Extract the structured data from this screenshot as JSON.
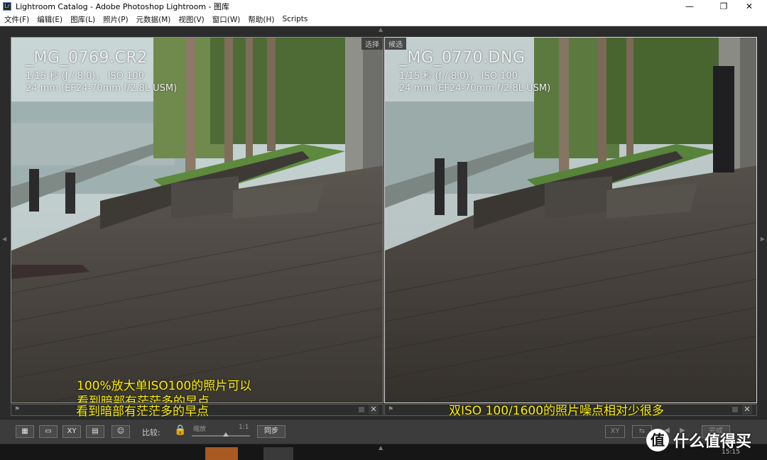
{
  "window": {
    "title": "Lightroom Catalog - Adobe Photoshop Lightroom - 图库",
    "app_icon_text": "Lr",
    "controls": {
      "minimize": "—",
      "maximize": "❐",
      "close": "✕"
    }
  },
  "menu": {
    "items": [
      "文件(F)",
      "编辑(E)",
      "图库(L)",
      "照片(P)",
      "元数据(M)",
      "视图(V)",
      "窗口(W)",
      "帮助(H)",
      "Scripts"
    ]
  },
  "left_pane": {
    "badge": "选择",
    "filename": "_MG_0769.CR2",
    "exposure": "1/15 秒 (ƒ / 8.0)， ISO 100",
    "lens": "24 mm (EF24-70mm f/2.8L USM)",
    "caption_line1": "100%放大单ISO100的照片可以",
    "caption_line2": "看到暗部有茫茫多的早点"
  },
  "right_pane": {
    "badge": "候选",
    "filename": "_MG_0770.DNG",
    "exposure": "1/15 秒 (ƒ / 8.0)， ISO 100",
    "lens": "24 mm (EF24-70mm f/2.8L USM)",
    "caption_line1": "双ISO 100/1600的照片噪点相对少很多"
  },
  "toolbar": {
    "compare_label": "比较:",
    "zoom_label": "缩放",
    "zoom_ratio": "1:1",
    "sync_button": "同步",
    "done_button": "完成",
    "xy_label": "XY",
    "zoom_level": 0.55
  },
  "filmstrip": {
    "time": "15:15"
  },
  "watermark": {
    "logo": "值",
    "text": "什么值得买"
  },
  "colors": {
    "caption": "#fff200",
    "background": "#2b2b2b"
  }
}
